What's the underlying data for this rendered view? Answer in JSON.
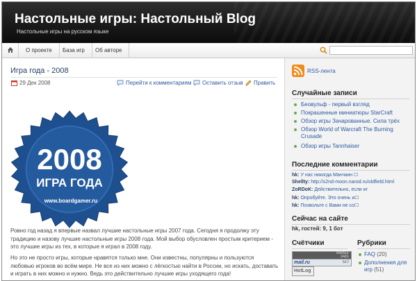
{
  "header": {
    "title": "Настольные игры: Настольный Blog",
    "tagline": "Настольные игры на русском языке"
  },
  "nav": {
    "items": [
      "О проекте",
      "База игр",
      "Об авторе"
    ],
    "search_placeholder": ""
  },
  "post": {
    "title": "Игра года - 2008",
    "date": "29 Дек 2008",
    "links": [
      "Перейти к комментариям",
      "Оставить отзыв",
      "Править"
    ],
    "badge": {
      "year": "2008",
      "caption": "ИГРА ГОДА",
      "site": "www.boardgamer.ru"
    },
    "paragraphs": [
      "Ровно год назад я впервые назвал лучшие настольные игры 2007 года. Сегодня я продолжу эту традицию и назову лучшие настольные игры 2008 года. Мой выбор обусловлен простым критерием - это лучшие игры из тех, в которые я играл в 2008 году.",
      "Но это не просто игры, которые нравятся только мне. Они известны, популярны и пользуются любовью игроков во всём мире. Не все из них можно с лёгкостью найти в России, но искать, доставать и играть в них можно и нужно. Ведь это действительно лучшие игры уходящего года!"
    ]
  },
  "sidebar": {
    "rss_label": "RSS-лента",
    "random_title": "Случайные записи",
    "random_items": [
      "Беовульф - первый взгляд",
      "Покрашенные миниатюры StarCraft",
      "Обзор игры Зачарованные. Сила трёх",
      "Обзор World of Warcraft The Burning Crusade",
      "Обзор игры Tannhaiser"
    ],
    "comments_title": "Последние комментарии",
    "comments": [
      {
        "author": "hk:",
        "text": "У нас никогда Манчкин ☐"
      },
      {
        "author": "Shellty:",
        "text": "http://s2nd-moon.narod.ru/oldfield.html"
      },
      {
        "author": "ZoRDoK:",
        "text": "Действительно, если иг"
      },
      {
        "author": "hk:",
        "text": "Опробуйте. Это очень и☐"
      },
      {
        "author": "hk:",
        "text": "Позвольте с Вами не со☐"
      }
    ],
    "online_title": "Сейчас на сайте",
    "online_user": "hk",
    "online_rest": ", гостей: 9, 1 бот",
    "counters_title": "Счётчики",
    "counter_numbers": [
      "542511",
      "2421",
      "517"
    ],
    "counter_liveinternet": "mail.ru",
    "counter_hotlog": "HotLog",
    "rubrics_title": "Рубрики",
    "rubrics": [
      {
        "name": "FAQ",
        "count": "(20)"
      },
      {
        "name": "Дополнения для игр",
        "count": "(51)"
      }
    ]
  },
  "colors": {
    "header_bg": "#1a1a1a",
    "link": "#2b5aa0",
    "badge_blue": "#1e4f8f",
    "bullet_green": "#6aa84f"
  }
}
